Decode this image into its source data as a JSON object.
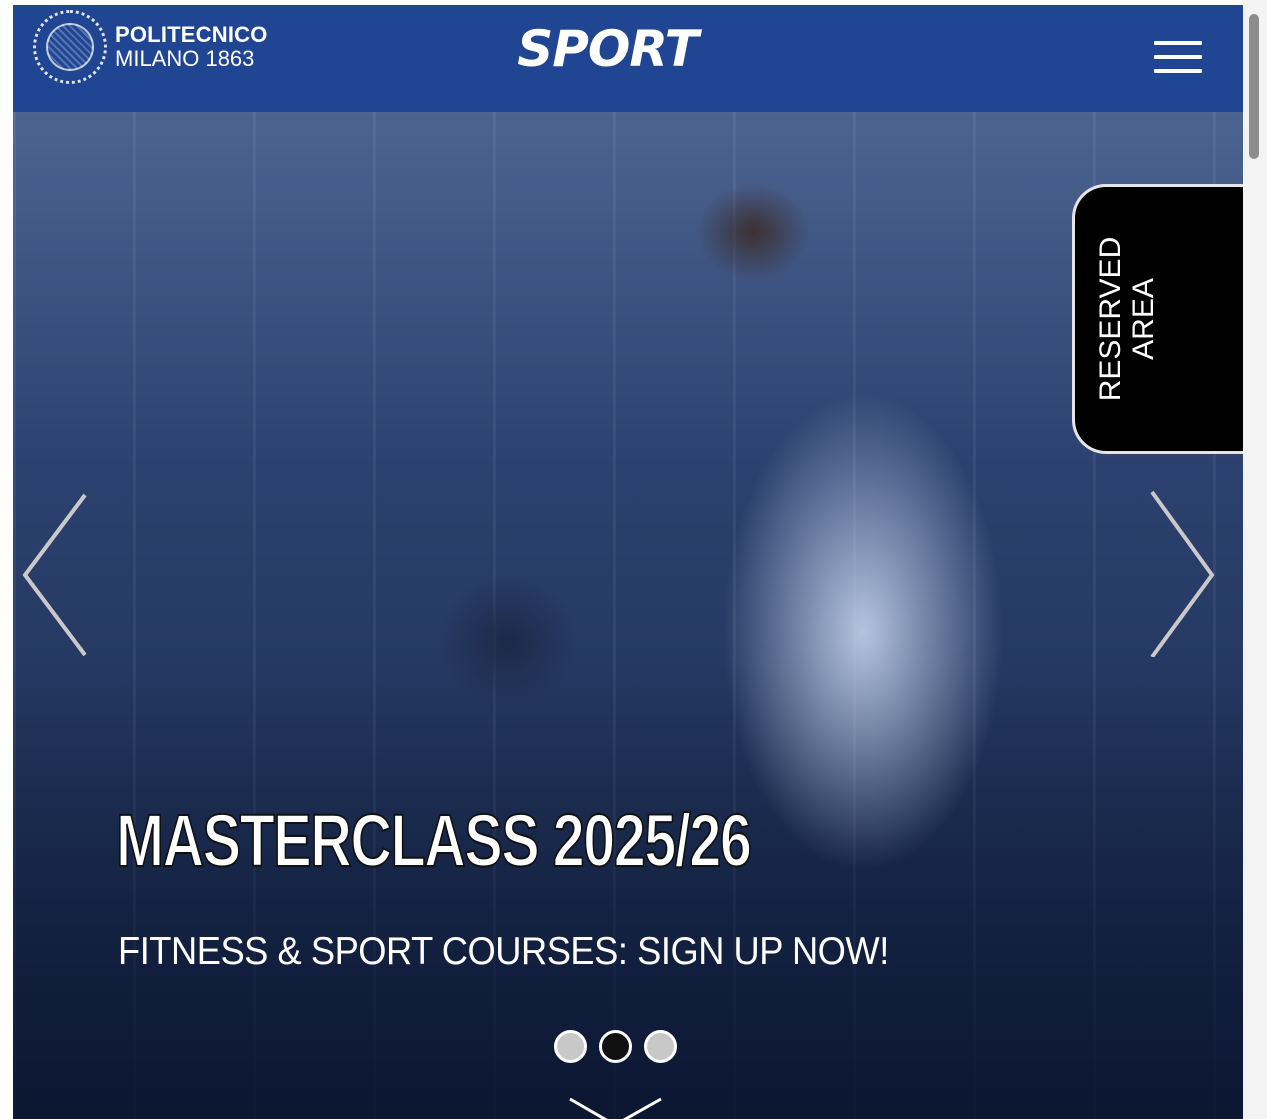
{
  "header": {
    "logo_line1": "POLITECNICO",
    "logo_line2": "MILANO 1863",
    "brand": "SPORT",
    "menu_icon": "hamburger-menu-icon",
    "background_color": "#1f4593"
  },
  "hero": {
    "title": "MASTERCLASS 2025/26",
    "subtitle": "FITNESS & SPORT COURSES: SIGN UP NOW!",
    "prev_icon": "chevron-left-icon",
    "next_icon": "chevron-right-icon",
    "scroll_icon": "chevron-down-icon",
    "slides_total": 3,
    "active_slide": 2
  },
  "reserved_area": {
    "label_line1": "RESERVED",
    "label_line2": "AREA",
    "background_color": "#000000"
  }
}
